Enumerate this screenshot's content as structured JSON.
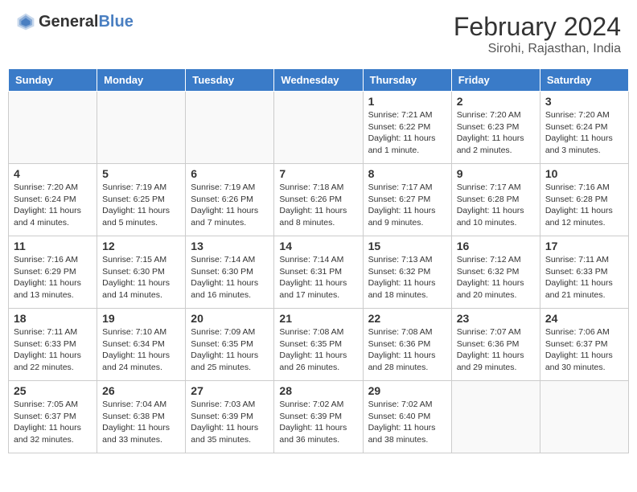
{
  "header": {
    "logo_general": "General",
    "logo_blue": "Blue",
    "title": "February 2024",
    "subtitle": "Sirohi, Rajasthan, India"
  },
  "columns": [
    "Sunday",
    "Monday",
    "Tuesday",
    "Wednesday",
    "Thursday",
    "Friday",
    "Saturday"
  ],
  "weeks": [
    [
      {
        "day": "",
        "info": ""
      },
      {
        "day": "",
        "info": ""
      },
      {
        "day": "",
        "info": ""
      },
      {
        "day": "",
        "info": ""
      },
      {
        "day": "1",
        "info": "Sunrise: 7:21 AM\nSunset: 6:22 PM\nDaylight: 11 hours and 1 minute."
      },
      {
        "day": "2",
        "info": "Sunrise: 7:20 AM\nSunset: 6:23 PM\nDaylight: 11 hours and 2 minutes."
      },
      {
        "day": "3",
        "info": "Sunrise: 7:20 AM\nSunset: 6:24 PM\nDaylight: 11 hours and 3 minutes."
      }
    ],
    [
      {
        "day": "4",
        "info": "Sunrise: 7:20 AM\nSunset: 6:24 PM\nDaylight: 11 hours and 4 minutes."
      },
      {
        "day": "5",
        "info": "Sunrise: 7:19 AM\nSunset: 6:25 PM\nDaylight: 11 hours and 5 minutes."
      },
      {
        "day": "6",
        "info": "Sunrise: 7:19 AM\nSunset: 6:26 PM\nDaylight: 11 hours and 7 minutes."
      },
      {
        "day": "7",
        "info": "Sunrise: 7:18 AM\nSunset: 6:26 PM\nDaylight: 11 hours and 8 minutes."
      },
      {
        "day": "8",
        "info": "Sunrise: 7:17 AM\nSunset: 6:27 PM\nDaylight: 11 hours and 9 minutes."
      },
      {
        "day": "9",
        "info": "Sunrise: 7:17 AM\nSunset: 6:28 PM\nDaylight: 11 hours and 10 minutes."
      },
      {
        "day": "10",
        "info": "Sunrise: 7:16 AM\nSunset: 6:28 PM\nDaylight: 11 hours and 12 minutes."
      }
    ],
    [
      {
        "day": "11",
        "info": "Sunrise: 7:16 AM\nSunset: 6:29 PM\nDaylight: 11 hours and 13 minutes."
      },
      {
        "day": "12",
        "info": "Sunrise: 7:15 AM\nSunset: 6:30 PM\nDaylight: 11 hours and 14 minutes."
      },
      {
        "day": "13",
        "info": "Sunrise: 7:14 AM\nSunset: 6:30 PM\nDaylight: 11 hours and 16 minutes."
      },
      {
        "day": "14",
        "info": "Sunrise: 7:14 AM\nSunset: 6:31 PM\nDaylight: 11 hours and 17 minutes."
      },
      {
        "day": "15",
        "info": "Sunrise: 7:13 AM\nSunset: 6:32 PM\nDaylight: 11 hours and 18 minutes."
      },
      {
        "day": "16",
        "info": "Sunrise: 7:12 AM\nSunset: 6:32 PM\nDaylight: 11 hours and 20 minutes."
      },
      {
        "day": "17",
        "info": "Sunrise: 7:11 AM\nSunset: 6:33 PM\nDaylight: 11 hours and 21 minutes."
      }
    ],
    [
      {
        "day": "18",
        "info": "Sunrise: 7:11 AM\nSunset: 6:33 PM\nDaylight: 11 hours and 22 minutes."
      },
      {
        "day": "19",
        "info": "Sunrise: 7:10 AM\nSunset: 6:34 PM\nDaylight: 11 hours and 24 minutes."
      },
      {
        "day": "20",
        "info": "Sunrise: 7:09 AM\nSunset: 6:35 PM\nDaylight: 11 hours and 25 minutes."
      },
      {
        "day": "21",
        "info": "Sunrise: 7:08 AM\nSunset: 6:35 PM\nDaylight: 11 hours and 26 minutes."
      },
      {
        "day": "22",
        "info": "Sunrise: 7:08 AM\nSunset: 6:36 PM\nDaylight: 11 hours and 28 minutes."
      },
      {
        "day": "23",
        "info": "Sunrise: 7:07 AM\nSunset: 6:36 PM\nDaylight: 11 hours and 29 minutes."
      },
      {
        "day": "24",
        "info": "Sunrise: 7:06 AM\nSunset: 6:37 PM\nDaylight: 11 hours and 30 minutes."
      }
    ],
    [
      {
        "day": "25",
        "info": "Sunrise: 7:05 AM\nSunset: 6:37 PM\nDaylight: 11 hours and 32 minutes."
      },
      {
        "day": "26",
        "info": "Sunrise: 7:04 AM\nSunset: 6:38 PM\nDaylight: 11 hours and 33 minutes."
      },
      {
        "day": "27",
        "info": "Sunrise: 7:03 AM\nSunset: 6:39 PM\nDaylight: 11 hours and 35 minutes."
      },
      {
        "day": "28",
        "info": "Sunrise: 7:02 AM\nSunset: 6:39 PM\nDaylight: 11 hours and 36 minutes."
      },
      {
        "day": "29",
        "info": "Sunrise: 7:02 AM\nSunset: 6:40 PM\nDaylight: 11 hours and 38 minutes."
      },
      {
        "day": "",
        "info": ""
      },
      {
        "day": "",
        "info": ""
      }
    ]
  ]
}
